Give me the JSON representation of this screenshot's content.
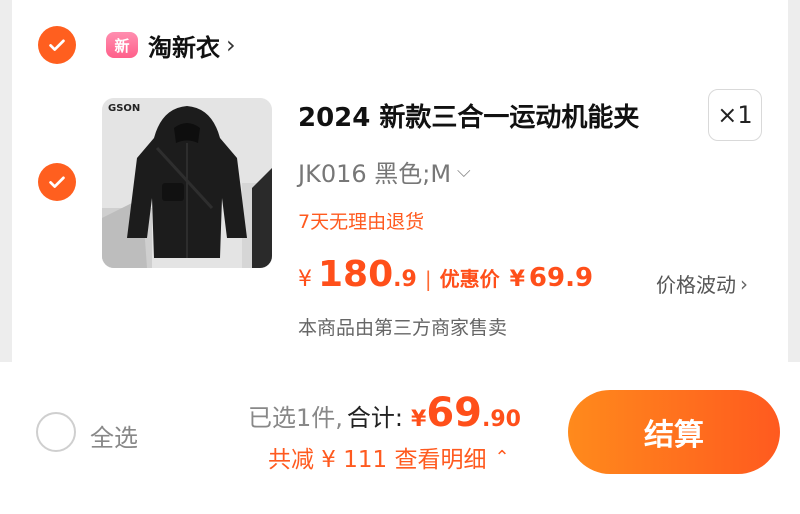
{
  "shop": {
    "badge": "新",
    "name": "淘新衣",
    "chevron": "›"
  },
  "item": {
    "thumbnail_brand": "GSON",
    "title": "2024 新款三合一运动机能夹",
    "quantity": "×1",
    "spec": "JK016 黑色;M",
    "spec_chevron": "⌵",
    "return_policy": "7天无理由退货",
    "price_currency": "¥",
    "price_int": "180",
    "price_dec": ".9",
    "separator": "|",
    "discount_label": "优惠价",
    "discount_currency": "¥",
    "discount_value": "69.9",
    "price_fluctuation": "价格波动",
    "fluct_chevron": "›",
    "seller_note": "本商品由第三方商家售卖"
  },
  "footer": {
    "select_all": "全选",
    "selected_count": "已选1件,",
    "total_label": "合计:",
    "total_currency": "¥",
    "total_int": "69",
    "total_dec": ".90",
    "saving": "共减 ¥ 111  查看明细",
    "saving_chevron": "⌃",
    "checkout_label": "结算"
  },
  "colors": {
    "accent": "#ff5f1f",
    "price": "#ff4f1a",
    "background": "#ededed"
  },
  "icons": {
    "shop_check": "check-icon",
    "item_check": "check-icon",
    "select_all": "radio-empty-icon"
  }
}
